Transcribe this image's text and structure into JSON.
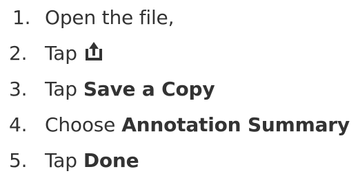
{
  "steps": [
    {
      "number": "1.",
      "text": "Open the file,",
      "bold": ""
    },
    {
      "number": "2.",
      "text": "Tap",
      "bold": "",
      "icon": "share-upload-icon"
    },
    {
      "number": "3.",
      "text": "Tap",
      "bold": "Save a Copy"
    },
    {
      "number": "4.",
      "text": "Choose",
      "bold": "Annotation Summary"
    },
    {
      "number": "5.",
      "text": "Tap",
      "bold": "Done"
    }
  ],
  "colors": {
    "text": "#333333",
    "background": "#ffffff"
  }
}
